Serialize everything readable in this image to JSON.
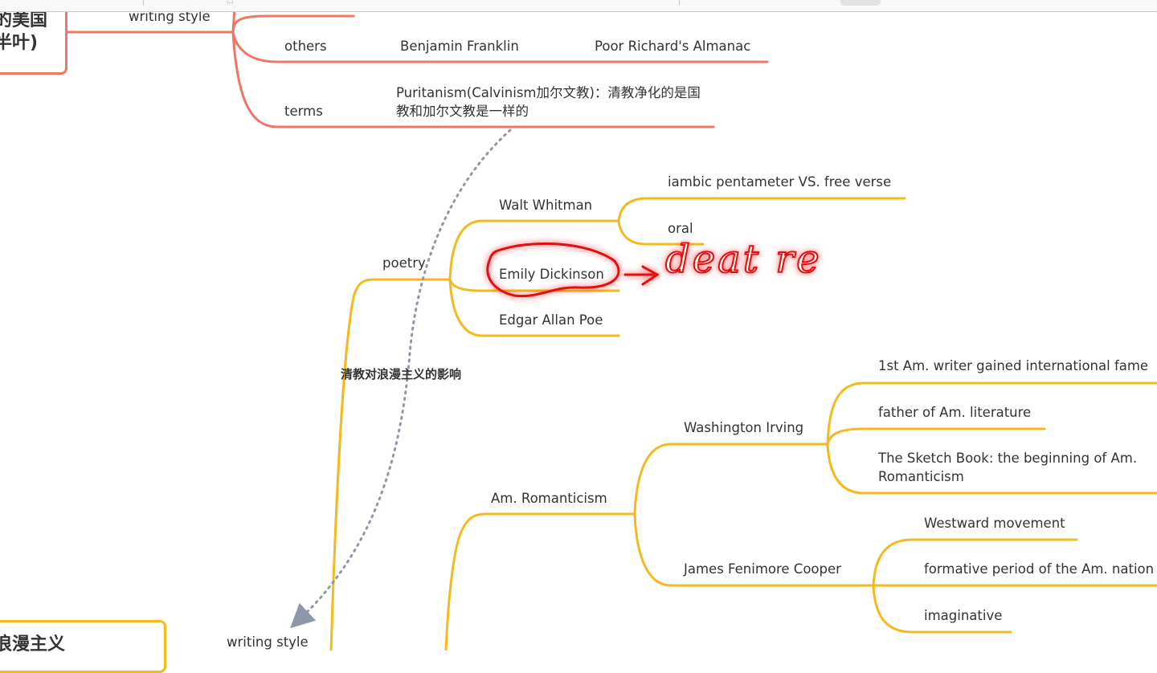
{
  "toolbar": {
    "glyphs": [
      "⬚",
      "|"
    ]
  },
  "colors": {
    "puritan_branch": "#f07565",
    "romantic_branch": "#f5b920",
    "relation_arrow": "#8e97a8",
    "annotation": "#e01010"
  },
  "mindmap": {
    "root_puritan": {
      "label": "的美国\n半叶)",
      "partial": true
    },
    "root_romantic": {
      "label": "浪漫主义",
      "partial": true
    },
    "puritan": {
      "writing_style": "writing style",
      "others": {
        "label": "others",
        "children": [
          "Benjamin Franklin",
          "Poor Richard's Almanac"
        ]
      },
      "terms": {
        "label": "terms",
        "children": [
          "Puritanism(Calvinism加尔文教)：清教净化的是国教和加尔文教是一样的"
        ]
      }
    },
    "relation": {
      "label": "清教对浪漫主义的影响"
    },
    "romantic": {
      "poetry": {
        "label": "poetry",
        "children": [
          {
            "label": "Walt Whitman",
            "children": [
              "iambic pentameter VS. free verse",
              "oral"
            ]
          },
          {
            "label": "Emily Dickinson"
          },
          {
            "label": "Edgar Allan Poe"
          }
        ]
      },
      "am_romanticism": {
        "label": "Am. Romanticism",
        "children": [
          {
            "label": "Washington Irving",
            "children": [
              "1st Am. writer gained international fame",
              "father of Am. literature",
              "The Sketch Book: the beginning of Am. Romanticism"
            ]
          },
          {
            "label": "James Fenimore Cooper",
            "children": [
              "Westward movement",
              "formative period of the Am. nation",
              "imaginative"
            ]
          }
        ]
      },
      "writing_style": "writing style"
    },
    "annotation": {
      "handwritten_text": "deat re",
      "circled_node": "Emily Dickinson"
    }
  }
}
